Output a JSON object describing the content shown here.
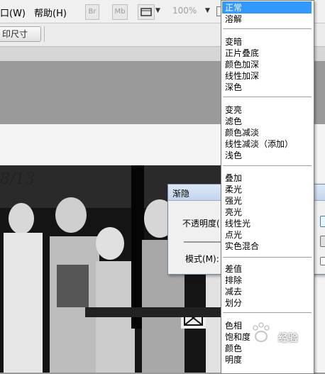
{
  "menubar": {
    "window_label": "口(W)",
    "help_label": "帮助(H)",
    "btn_br": "Br",
    "btn_mb": "Mb",
    "zoom": "100%"
  },
  "options_bar": {
    "print_size_label": "印尺寸"
  },
  "photo": {
    "date_text": "8/13"
  },
  "fade_dialog": {
    "title": "渐隐",
    "opacity_label": "不透明度(",
    "mode_label": "模式(M):"
  },
  "blend_modes": {
    "selected": "正常",
    "groups": [
      [
        "正常",
        "溶解"
      ],
      [
        "变暗",
        "正片叠底",
        "颜色加深",
        "线性加深",
        "深色"
      ],
      [
        "变亮",
        "滤色",
        "颜色减淡",
        "线性减淡（添加）",
        "浅色"
      ],
      [
        "叠加",
        "柔光",
        "强光",
        "亮光",
        "线性光",
        "点光",
        "实色混合"
      ],
      [
        "差值",
        "排除",
        "减去",
        "划分"
      ],
      [
        "色相",
        "饱和度",
        "颜色",
        "明度"
      ]
    ]
  },
  "watermark": {
    "text": "经验"
  }
}
